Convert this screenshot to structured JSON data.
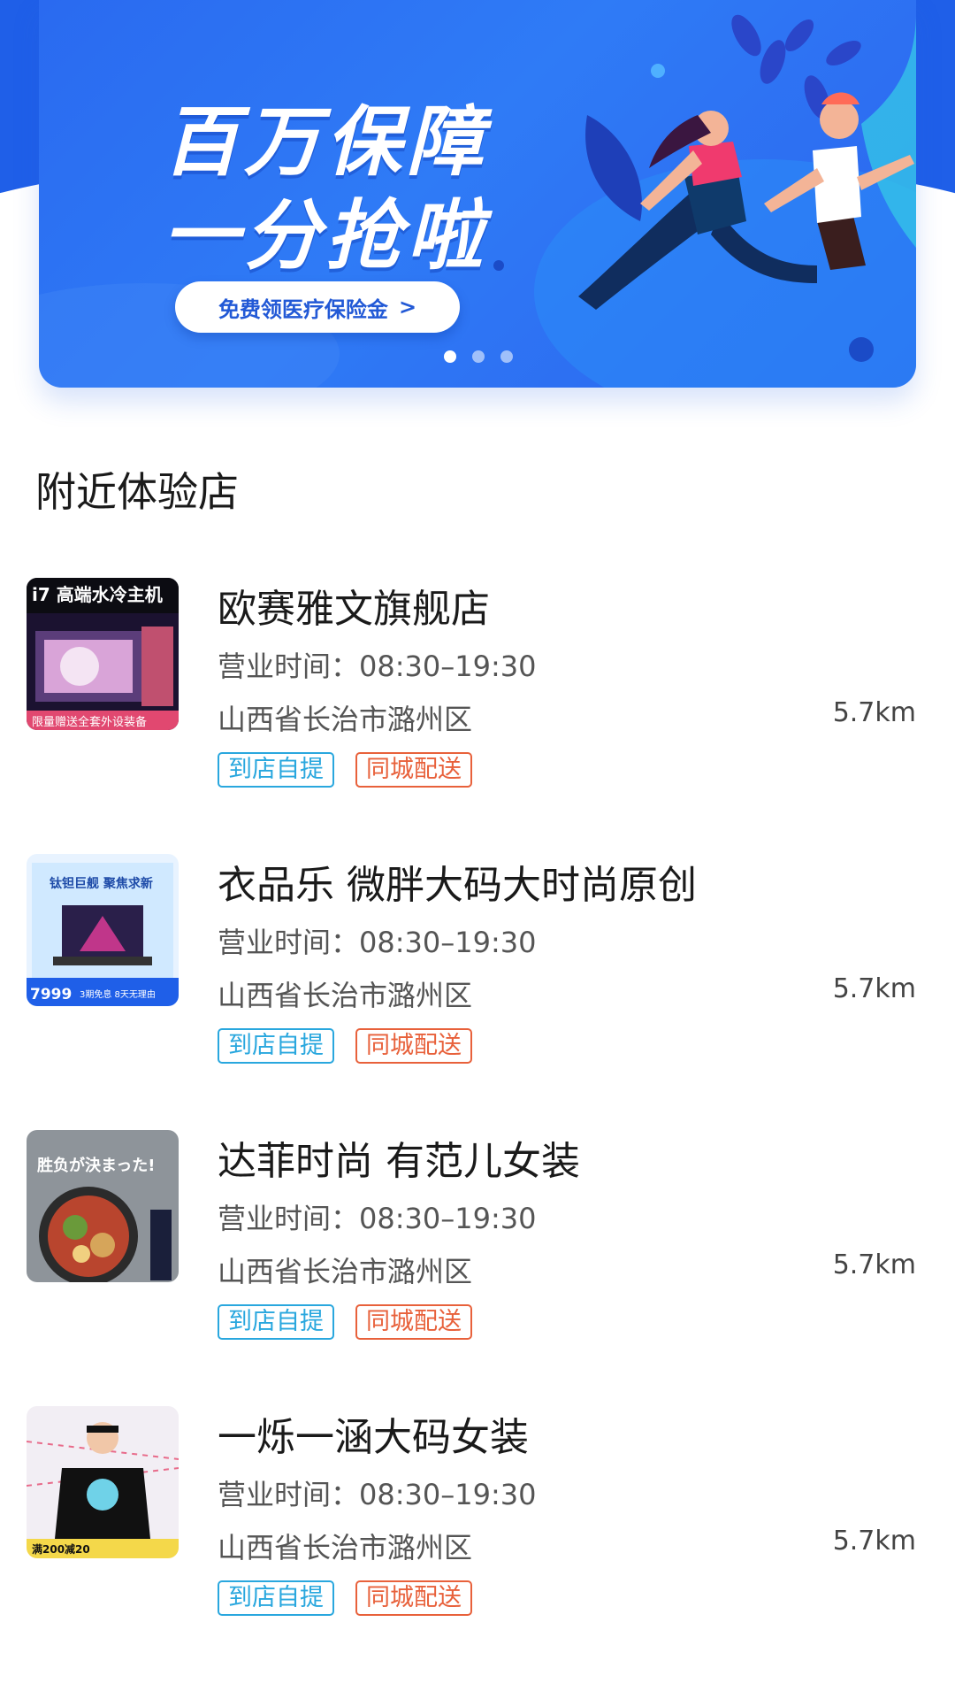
{
  "banner": {
    "headline_line1": "百万保障",
    "headline_line2": "一分抢啦",
    "cta_label": "免费领医疗保险金",
    "cta_arrow": ">",
    "slide_count": 3,
    "active_slide": 1
  },
  "section": {
    "title": "附近体验店"
  },
  "stores": [
    {
      "name": "欧赛雅文旗舰店",
      "hours": "营业时间：08:30–19:30",
      "address": "山西省长治市潞州区",
      "distance": "5.7km",
      "tags": [
        "到店自提",
        "同城配送"
      ],
      "thumb_text": "i7 高端水冷主机",
      "thumb_sub": "限量赠送全套外设装备"
    },
    {
      "name": "衣品乐 微胖大码大时尚原创",
      "hours": "营业时间：08:30–19:30",
      "address": "山西省长治市潞州区",
      "distance": "5.7km",
      "tags": [
        "到店自提",
        "同城配送"
      ],
      "thumb_text": "钛钽巨舰 聚焦求新",
      "thumb_sub": "7999",
      "thumb_sub2": "3期免息 8天无理由"
    },
    {
      "name": "达菲时尚 有范儿女装",
      "hours": "营业时间：08:30–19:30",
      "address": "山西省长治市潞州区",
      "distance": "5.7km",
      "tags": [
        "到店自提",
        "同城配送"
      ],
      "thumb_text": "胜负が決まった!"
    },
    {
      "name": "一烁一涵大码女装",
      "hours": "营业时间：08:30–19:30",
      "address": "山西省长治市潞州区",
      "distance": "5.7km",
      "tags": [
        "到店自提",
        "同城配送"
      ],
      "thumb_text": "满200减20"
    }
  ],
  "colors": {
    "brand_blue": "#1f5fe8",
    "pickup_tag": "#29a7de",
    "delivery_tag": "#e8613b"
  }
}
